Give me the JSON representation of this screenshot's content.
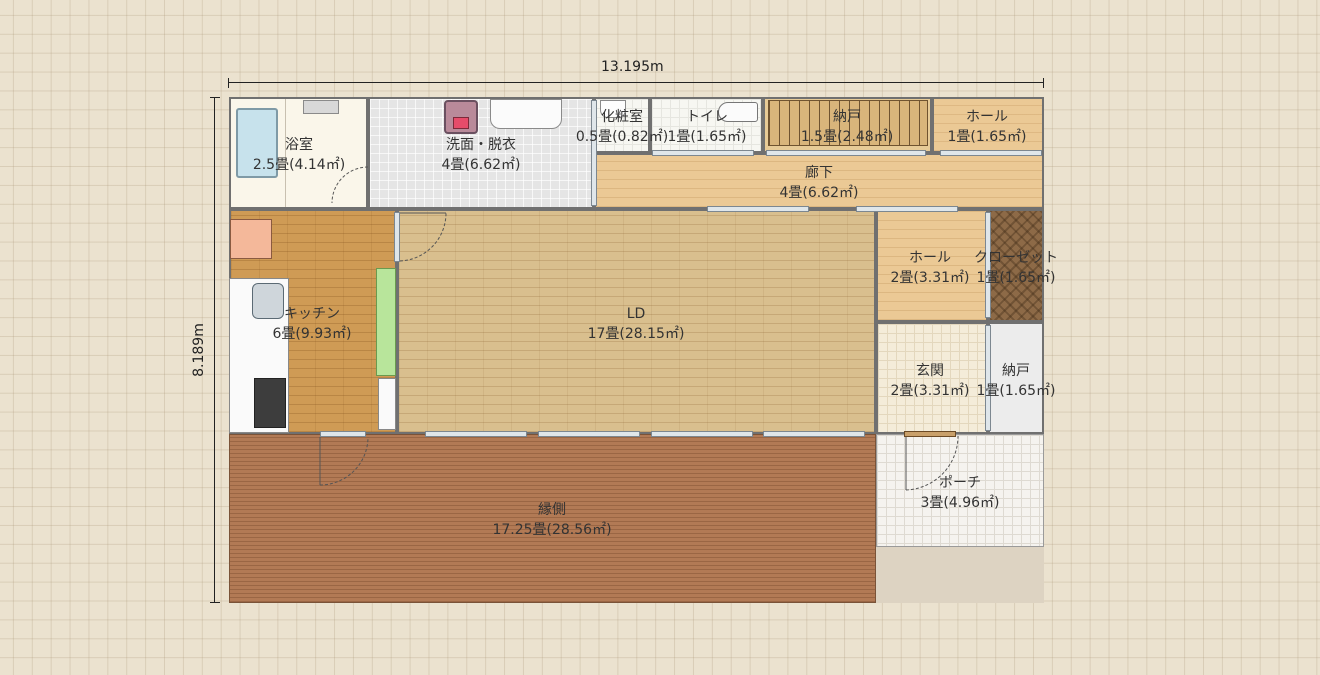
{
  "dimensions": {
    "width": "13.195m",
    "height": "8.189m"
  },
  "rooms": {
    "bath": {
      "name": "浴室",
      "size": "2.5畳(4.14㎡)"
    },
    "wash": {
      "name": "洗面・脱衣",
      "size": "4畳(6.62㎡)"
    },
    "powder": {
      "name": "化粧室",
      "size": "0.5畳(0.82㎡)"
    },
    "toilet": {
      "name": "トイレ",
      "size": "1畳(1.65㎡)"
    },
    "storage_top": {
      "name": "納戸",
      "size": "1.5畳(2.48㎡)"
    },
    "hall_top": {
      "name": "ホール",
      "size": "1畳(1.65㎡)"
    },
    "corridor": {
      "name": "廊下",
      "size": "4畳(6.62㎡)"
    },
    "kitchen": {
      "name": "キッチン",
      "size": "6畳(9.93㎡)"
    },
    "ld": {
      "name": "LD",
      "size": "17畳(28.15㎡)"
    },
    "hall_mid": {
      "name": "ホール",
      "size": "2畳(3.31㎡)"
    },
    "closet": {
      "name": "クローゼット",
      "size": "1畳(1.65㎡)"
    },
    "entrance": {
      "name": "玄関",
      "size": "2畳(3.31㎡)"
    },
    "storage_mid": {
      "name": "納戸",
      "size": "1畳(1.65㎡)"
    },
    "porch": {
      "name": "ポーチ",
      "size": "3畳(4.96㎡)"
    },
    "engawa": {
      "name": "縁側",
      "size": "17.25畳(28.56㎡)"
    }
  },
  "colors": {
    "wood_light": "#e9c890",
    "wood_kitchen": "#cf9b55",
    "ld_floor": "#d9bf8e",
    "engawa": "#b27a55",
    "tile_gray": "#e4e4e4",
    "tile_cream": "#f7f1e4",
    "closet": "#8d6a47"
  }
}
